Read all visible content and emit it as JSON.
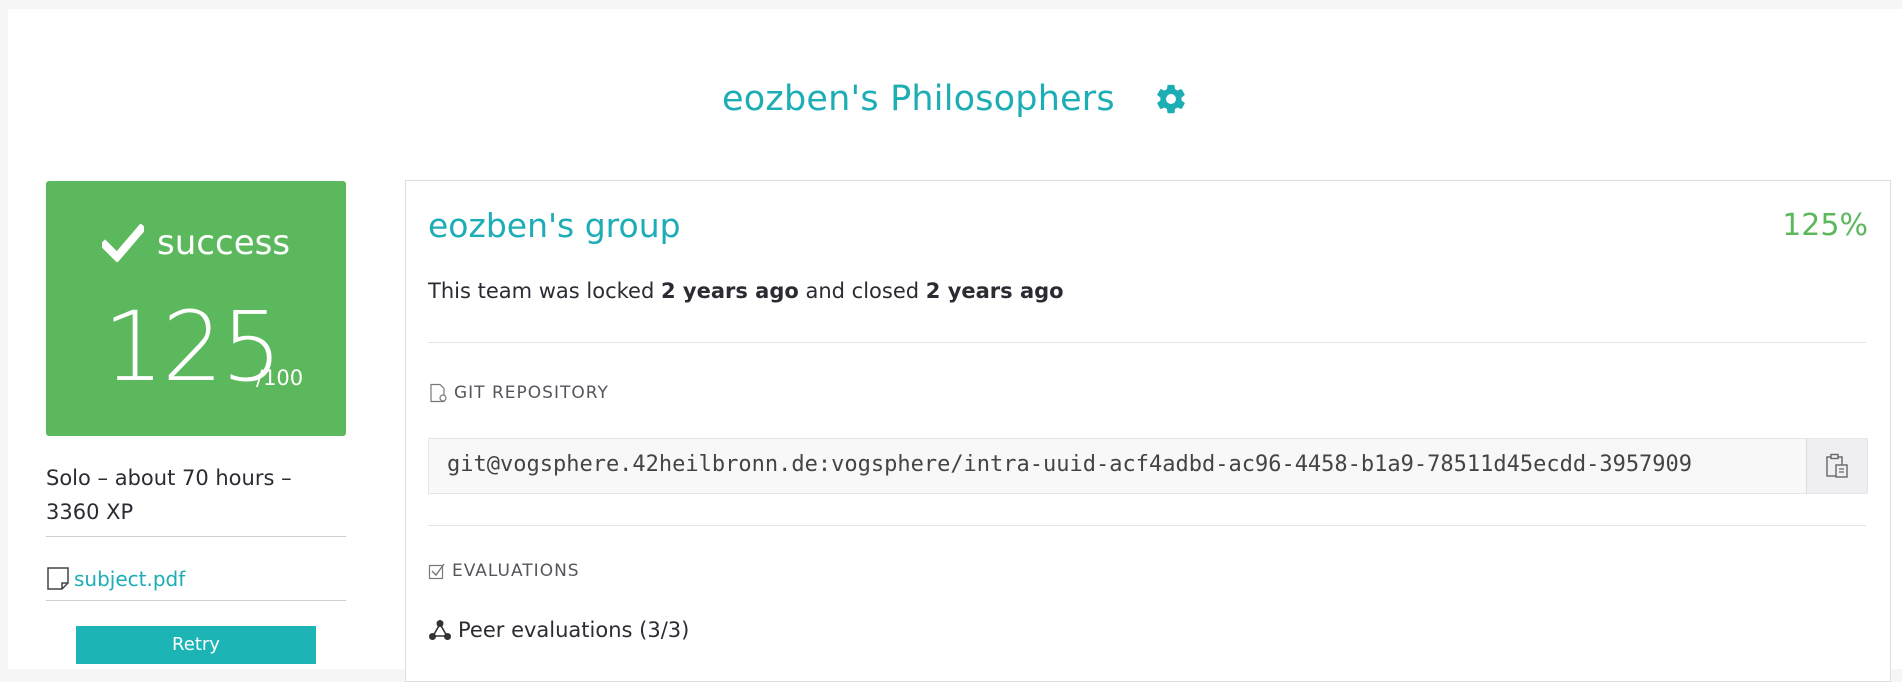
{
  "header": {
    "title": "eozben's Philosophers",
    "settings_icon": "gear-icon",
    "accent_color": "#1dadb4"
  },
  "status": {
    "icon": "check-icon",
    "label": "success",
    "score": "125",
    "score_max": "/100",
    "color": "#5cb85c"
  },
  "project_meta": {
    "info": "Solo – about 70 hours – 3360 XP",
    "subject_link": "subject.pdf",
    "subject_icon": "file-icon",
    "retry_label": "Retry"
  },
  "team": {
    "name": "eozben's group",
    "percent": "125%",
    "lock_prefix": "This team was locked ",
    "locked_ago": "2 years ago",
    "lock_middle": " and closed ",
    "closed_ago": "2 years ago"
  },
  "git": {
    "section_label": "GIT REPOSITORY",
    "section_icon": "git-file-icon",
    "url": "git@vogsphere.42heilbronn.de:vogsphere/intra-uuid-acf4adbd-ac96-4458-b1a9-78511d45ecdd-3957909",
    "copy_icon": "clipboard-icon"
  },
  "evaluations": {
    "section_label": "EVALUATIONS",
    "section_icon": "checkbox-icon",
    "peer_label": "Peer evaluations (3/3)",
    "peer_icon": "peers-icon"
  }
}
